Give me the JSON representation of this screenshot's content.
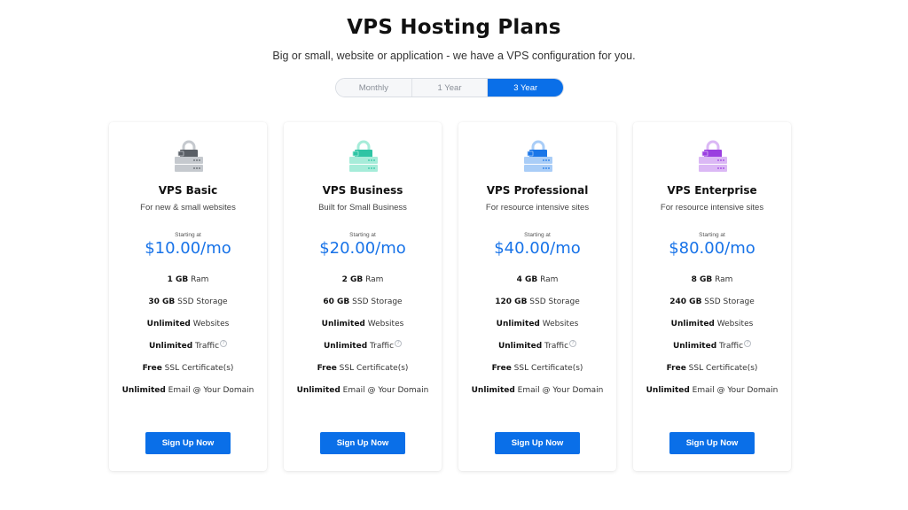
{
  "header": {
    "title": "VPS Hosting Plans",
    "subtitle": "Big or small, website or application - we have a VPS configuration for you."
  },
  "billing_toggle": {
    "options": [
      "Monthly",
      "1 Year",
      "3 Year"
    ],
    "selected": "3 Year"
  },
  "colors": {
    "accent": "#0a6fe8",
    "price": "#1873e8"
  },
  "plans": [
    {
      "name": "VPS Basic",
      "description": "For new & small websites",
      "icon": "server-lock-icon",
      "icon_color": "#5a5f66",
      "icon_light": "#c5c9ce",
      "starting_label": "Starting at",
      "price": "$10.00/mo",
      "features": [
        {
          "bold": "1 GB",
          "text": " Ram"
        },
        {
          "bold": "30 GB",
          "text": " SSD Storage"
        },
        {
          "bold": "Unlimited",
          "text": " Websites"
        },
        {
          "bold": "Unlimited",
          "text": " Traffic",
          "help": "?"
        },
        {
          "bold": "Free",
          "text": " SSL Certificate(s)"
        },
        {
          "bold": "Unlimited",
          "text": " Email @ Your Domain"
        }
      ],
      "cta": "Sign Up Now"
    },
    {
      "name": "VPS Business",
      "description": "Built for Small Business",
      "icon": "server-lock-icon",
      "icon_color": "#2ec4a4",
      "icon_light": "#a6ecd9",
      "starting_label": "Starting at",
      "price": "$20.00/mo",
      "features": [
        {
          "bold": "2 GB",
          "text": " Ram"
        },
        {
          "bold": "60 GB",
          "text": " SSD Storage"
        },
        {
          "bold": "Unlimited",
          "text": " Websites"
        },
        {
          "bold": "Unlimited",
          "text": " Traffic",
          "help": "?"
        },
        {
          "bold": "Free",
          "text": " SSL Certificate(s)"
        },
        {
          "bold": "Unlimited",
          "text": " Email @ Your Domain"
        }
      ],
      "cta": "Sign Up Now"
    },
    {
      "name": "VPS Professional",
      "description": "For resource intensive sites",
      "icon": "server-lock-icon",
      "icon_color": "#1a76e8",
      "icon_light": "#a9cdf7",
      "starting_label": "Starting at",
      "price": "$40.00/mo",
      "features": [
        {
          "bold": "4 GB",
          "text": " Ram"
        },
        {
          "bold": "120 GB",
          "text": " SSD Storage"
        },
        {
          "bold": "Unlimited",
          "text": " Websites"
        },
        {
          "bold": "Unlimited",
          "text": " Traffic",
          "help": "?"
        },
        {
          "bold": "Free",
          "text": " SSL Certificate(s)"
        },
        {
          "bold": "Unlimited",
          "text": " Email @ Your Domain"
        }
      ],
      "cta": "Sign Up Now"
    },
    {
      "name": "VPS Enterprise",
      "description": "For resource intensive sites",
      "icon": "server-lock-icon",
      "icon_color": "#9a3fe0",
      "icon_light": "#dbb8f5",
      "starting_label": "Starting at",
      "price": "$80.00/mo",
      "features": [
        {
          "bold": "8 GB",
          "text": " Ram"
        },
        {
          "bold": "240 GB",
          "text": " SSD Storage"
        },
        {
          "bold": "Unlimited",
          "text": " Websites"
        },
        {
          "bold": "Unlimited",
          "text": " Traffic",
          "help": "?"
        },
        {
          "bold": "Free",
          "text": " SSL Certificate(s)"
        },
        {
          "bold": "Unlimited",
          "text": " Email @ Your Domain"
        }
      ],
      "cta": "Sign Up Now"
    }
  ]
}
